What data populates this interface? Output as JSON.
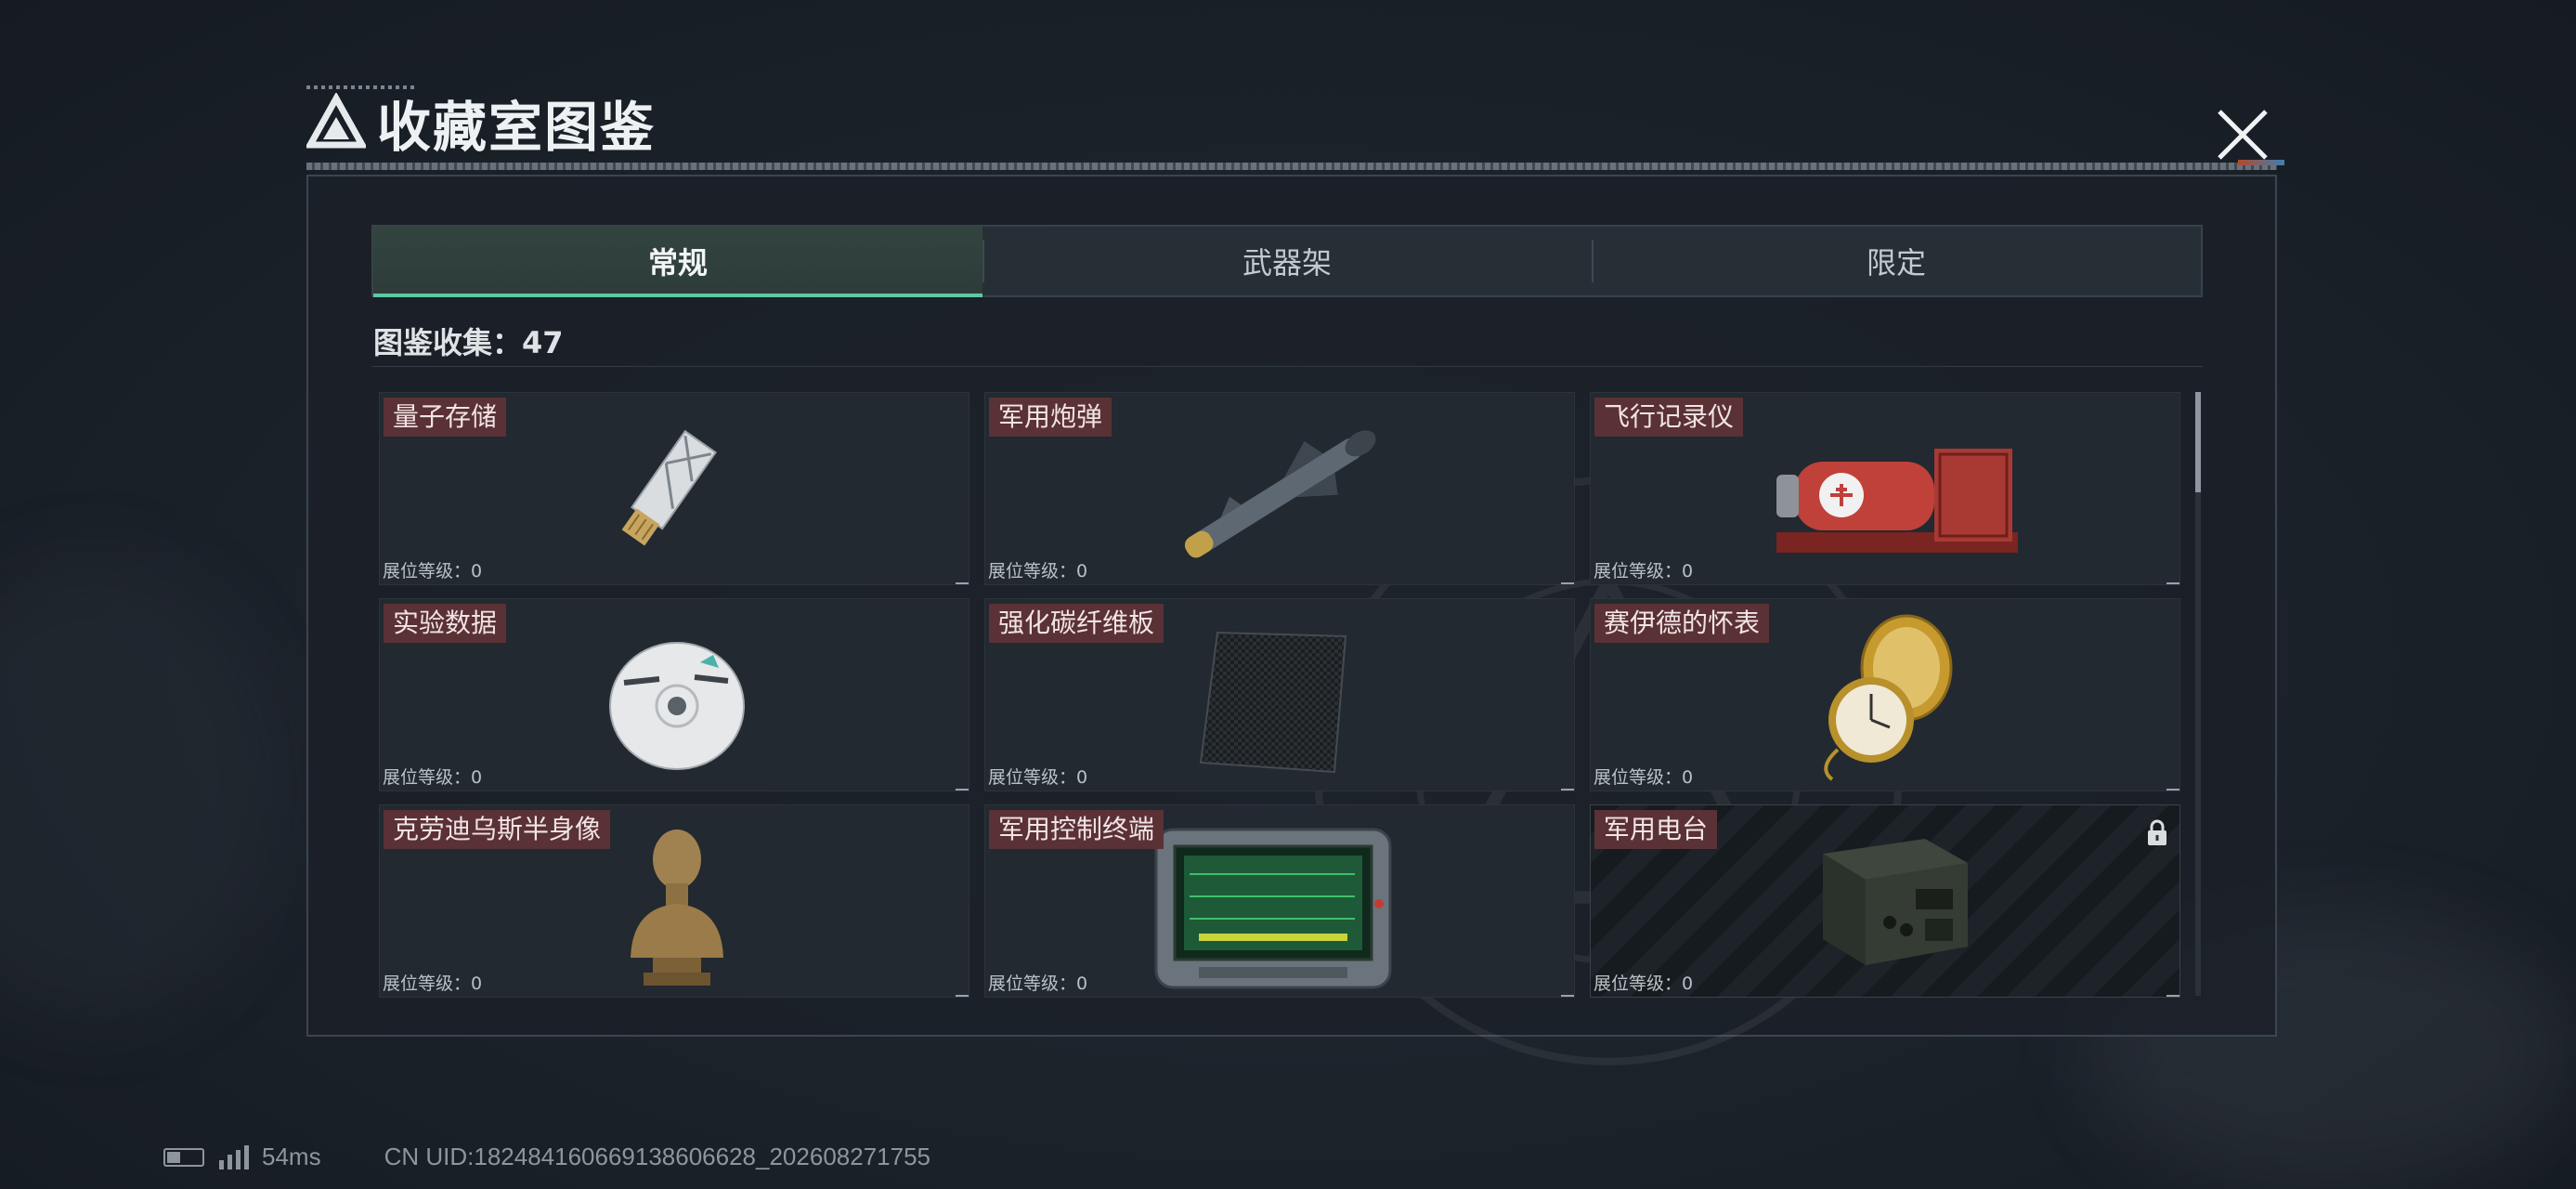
{
  "header": {
    "title": "收藏室图鉴"
  },
  "tabs": [
    {
      "label": "常规",
      "active": true
    },
    {
      "label": "武器架",
      "active": false
    },
    {
      "label": "限定",
      "active": false
    }
  ],
  "collection": {
    "label": "图鉴收集：",
    "count": "47"
  },
  "items": [
    {
      "name": "量子存储",
      "level": "展位等级：0",
      "icon": "quantum-storage-usb",
      "locked": false
    },
    {
      "name": "军用炮弹",
      "level": "展位等级：0",
      "icon": "military-missile",
      "locked": false
    },
    {
      "name": "飞行记录仪",
      "level": "展位等级：0",
      "icon": "flight-recorder",
      "locked": false
    },
    {
      "name": "实验数据",
      "level": "展位等级：0",
      "icon": "data-disc",
      "locked": false
    },
    {
      "name": "强化碳纤维板",
      "level": "展位等级：0",
      "icon": "carbon-fiber-plate",
      "locked": false
    },
    {
      "name": "赛伊德的怀表",
      "level": "展位等级：0",
      "icon": "pocket-watch",
      "locked": false
    },
    {
      "name": "克劳迪乌斯半身像",
      "level": "展位等级：0",
      "icon": "bronze-bust",
      "locked": false
    },
    {
      "name": "军用控制终端",
      "level": "展位等级：0",
      "icon": "control-terminal",
      "locked": false
    },
    {
      "name": "军用电台",
      "level": "展位等级：0",
      "icon": "military-radio",
      "locked": true
    }
  ],
  "status": {
    "ping": "54ms",
    "uid": "CN UID:18248416066913860​6628_202608271755"
  },
  "colors": {
    "accent": "#5fc9a6",
    "name_tag": "#5a3135",
    "panel": "#1b2128"
  }
}
